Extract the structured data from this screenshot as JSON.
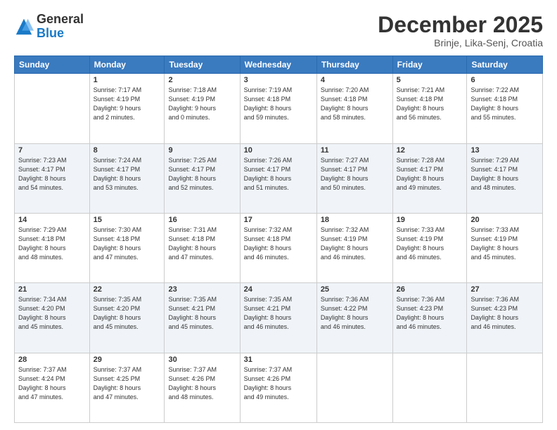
{
  "header": {
    "logo_general": "General",
    "logo_blue": "Blue",
    "month": "December 2025",
    "location": "Brinje, Lika-Senj, Croatia"
  },
  "days_of_week": [
    "Sunday",
    "Monday",
    "Tuesday",
    "Wednesday",
    "Thursday",
    "Friday",
    "Saturday"
  ],
  "weeks": [
    [
      {
        "day": "",
        "info": ""
      },
      {
        "day": "1",
        "info": "Sunrise: 7:17 AM\nSunset: 4:19 PM\nDaylight: 9 hours\nand 2 minutes."
      },
      {
        "day": "2",
        "info": "Sunrise: 7:18 AM\nSunset: 4:19 PM\nDaylight: 9 hours\nand 0 minutes."
      },
      {
        "day": "3",
        "info": "Sunrise: 7:19 AM\nSunset: 4:18 PM\nDaylight: 8 hours\nand 59 minutes."
      },
      {
        "day": "4",
        "info": "Sunrise: 7:20 AM\nSunset: 4:18 PM\nDaylight: 8 hours\nand 58 minutes."
      },
      {
        "day": "5",
        "info": "Sunrise: 7:21 AM\nSunset: 4:18 PM\nDaylight: 8 hours\nand 56 minutes."
      },
      {
        "day": "6",
        "info": "Sunrise: 7:22 AM\nSunset: 4:18 PM\nDaylight: 8 hours\nand 55 minutes."
      }
    ],
    [
      {
        "day": "7",
        "info": "Sunrise: 7:23 AM\nSunset: 4:17 PM\nDaylight: 8 hours\nand 54 minutes."
      },
      {
        "day": "8",
        "info": "Sunrise: 7:24 AM\nSunset: 4:17 PM\nDaylight: 8 hours\nand 53 minutes."
      },
      {
        "day": "9",
        "info": "Sunrise: 7:25 AM\nSunset: 4:17 PM\nDaylight: 8 hours\nand 52 minutes."
      },
      {
        "day": "10",
        "info": "Sunrise: 7:26 AM\nSunset: 4:17 PM\nDaylight: 8 hours\nand 51 minutes."
      },
      {
        "day": "11",
        "info": "Sunrise: 7:27 AM\nSunset: 4:17 PM\nDaylight: 8 hours\nand 50 minutes."
      },
      {
        "day": "12",
        "info": "Sunrise: 7:28 AM\nSunset: 4:17 PM\nDaylight: 8 hours\nand 49 minutes."
      },
      {
        "day": "13",
        "info": "Sunrise: 7:29 AM\nSunset: 4:17 PM\nDaylight: 8 hours\nand 48 minutes."
      }
    ],
    [
      {
        "day": "14",
        "info": "Sunrise: 7:29 AM\nSunset: 4:18 PM\nDaylight: 8 hours\nand 48 minutes."
      },
      {
        "day": "15",
        "info": "Sunrise: 7:30 AM\nSunset: 4:18 PM\nDaylight: 8 hours\nand 47 minutes."
      },
      {
        "day": "16",
        "info": "Sunrise: 7:31 AM\nSunset: 4:18 PM\nDaylight: 8 hours\nand 47 minutes."
      },
      {
        "day": "17",
        "info": "Sunrise: 7:32 AM\nSunset: 4:18 PM\nDaylight: 8 hours\nand 46 minutes."
      },
      {
        "day": "18",
        "info": "Sunrise: 7:32 AM\nSunset: 4:19 PM\nDaylight: 8 hours\nand 46 minutes."
      },
      {
        "day": "19",
        "info": "Sunrise: 7:33 AM\nSunset: 4:19 PM\nDaylight: 8 hours\nand 46 minutes."
      },
      {
        "day": "20",
        "info": "Sunrise: 7:33 AM\nSunset: 4:19 PM\nDaylight: 8 hours\nand 45 minutes."
      }
    ],
    [
      {
        "day": "21",
        "info": "Sunrise: 7:34 AM\nSunset: 4:20 PM\nDaylight: 8 hours\nand 45 minutes."
      },
      {
        "day": "22",
        "info": "Sunrise: 7:35 AM\nSunset: 4:20 PM\nDaylight: 8 hours\nand 45 minutes."
      },
      {
        "day": "23",
        "info": "Sunrise: 7:35 AM\nSunset: 4:21 PM\nDaylight: 8 hours\nand 45 minutes."
      },
      {
        "day": "24",
        "info": "Sunrise: 7:35 AM\nSunset: 4:21 PM\nDaylight: 8 hours\nand 46 minutes."
      },
      {
        "day": "25",
        "info": "Sunrise: 7:36 AM\nSunset: 4:22 PM\nDaylight: 8 hours\nand 46 minutes."
      },
      {
        "day": "26",
        "info": "Sunrise: 7:36 AM\nSunset: 4:23 PM\nDaylight: 8 hours\nand 46 minutes."
      },
      {
        "day": "27",
        "info": "Sunrise: 7:36 AM\nSunset: 4:23 PM\nDaylight: 8 hours\nand 46 minutes."
      }
    ],
    [
      {
        "day": "28",
        "info": "Sunrise: 7:37 AM\nSunset: 4:24 PM\nDaylight: 8 hours\nand 47 minutes."
      },
      {
        "day": "29",
        "info": "Sunrise: 7:37 AM\nSunset: 4:25 PM\nDaylight: 8 hours\nand 47 minutes."
      },
      {
        "day": "30",
        "info": "Sunrise: 7:37 AM\nSunset: 4:26 PM\nDaylight: 8 hours\nand 48 minutes."
      },
      {
        "day": "31",
        "info": "Sunrise: 7:37 AM\nSunset: 4:26 PM\nDaylight: 8 hours\nand 49 minutes."
      },
      {
        "day": "",
        "info": ""
      },
      {
        "day": "",
        "info": ""
      },
      {
        "day": "",
        "info": ""
      }
    ]
  ]
}
